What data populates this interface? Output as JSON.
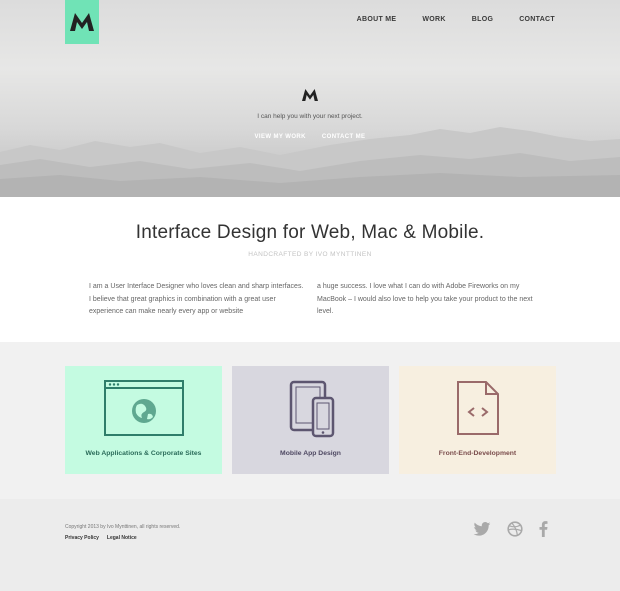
{
  "nav": {
    "items": [
      "ABOUT ME",
      "WORK",
      "BLOG",
      "CONTACT"
    ]
  },
  "hero": {
    "tagline": "I can help you with your next project.",
    "view_work": "VIEW MY WORK",
    "contact_me": "CONTACT ME"
  },
  "intro": {
    "title": "Interface Design for Web, Mac & Mobile.",
    "subtitle": "HANDCRAFTED BY IVO MYNTTINEN",
    "col1": "I am a User Interface Designer who loves clean and sharp interfaces. I believe that great graphics in combination with a great user experience can make nearly every app or website",
    "col2": "a huge success. I love what I can do with Adobe Fireworks on my MacBook – I would also love to help you take your product to the next level."
  },
  "services": [
    {
      "label": "Web Applications & Corporate Sites",
      "icon": "browser-globe-icon",
      "bg": "#c4fbe1"
    },
    {
      "label": "Mobile App Design",
      "icon": "tablet-phone-icon",
      "bg": "#d8d7df"
    },
    {
      "label": "Front-End-Development",
      "icon": "code-file-icon",
      "bg": "#f7efe0"
    }
  ],
  "footer": {
    "copyright": "Copyright 2013 by Ivo Mynttinen, all rights reserved.",
    "privacy": "Privacy Policy",
    "legal": "Legal Notice",
    "social": [
      "twitter-icon",
      "dribbble-icon",
      "facebook-icon"
    ]
  },
  "colors": {
    "accent": "#70e3b6"
  }
}
